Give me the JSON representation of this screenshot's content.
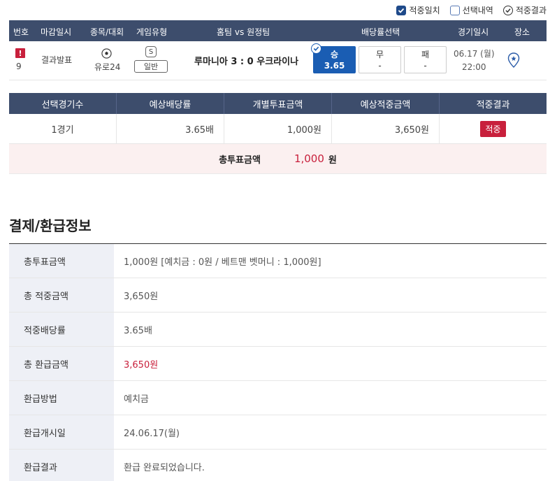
{
  "filters": [
    {
      "label": "적중일치",
      "state": "checked"
    },
    {
      "label": "선택내역",
      "state": "empty"
    },
    {
      "label": "적중결과",
      "state": "circle"
    }
  ],
  "game_table": {
    "headers": [
      "번호",
      "마감일시",
      "종목/대회",
      "게임유형",
      "홈팀 vs 원정팀",
      "배당률선택",
      "경기일시",
      "장소"
    ],
    "row": {
      "alert": "!",
      "number": "9",
      "deadline": "결과발표",
      "sport_icon": "soccer-ball-icon",
      "league": "유로24",
      "type_badge": "S",
      "type": "일반",
      "match": "루마니아 3 : 0 우크라이나",
      "odds": {
        "win_label": "승",
        "win_value": "3.65",
        "draw_label": "무",
        "draw_value": "-",
        "lose_label": "패",
        "lose_value": "-"
      },
      "date": "06.17 (월)",
      "time": "22:00",
      "venue_icon": "map-pin-icon"
    }
  },
  "summary": {
    "headers": [
      "선택경기수",
      "예상배당률",
      "개별투표금액",
      "예상적중금액",
      "적중결과"
    ],
    "values": [
      "1경기",
      "3.65배",
      "1,000원",
      "3,650원",
      "적중"
    ],
    "total_label": "총투표금액",
    "total_value": "1,000",
    "total_unit": "원"
  },
  "payment": {
    "title": "결제/환급정보",
    "rows": [
      {
        "label": "총투표금액",
        "value": "1,000원 [예치금 : 0원 / 베트맨 벳머니 : 1,000원]"
      },
      {
        "label": "총 적중금액",
        "value": "3,650원"
      },
      {
        "label": "적중배당률",
        "value": "3.65배"
      },
      {
        "label": "총 환급금액",
        "value": "3,650원"
      },
      {
        "label": "환급방법",
        "value": "예치금"
      },
      {
        "label": "환급개시일",
        "value": "24.06.17(월)"
      },
      {
        "label": "환급결과",
        "value": "환급 완료되었습니다."
      }
    ]
  },
  "colors": {
    "header_bg": "#3d4d6c",
    "accent_blue": "#1a5db3",
    "accent_red": "#c8203c",
    "label_bg": "#eef0f6",
    "total_bg": "#fbf0f0"
  }
}
